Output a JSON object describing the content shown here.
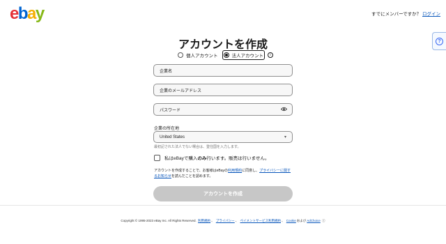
{
  "header": {
    "logo": {
      "e": "e",
      "b": "b",
      "a": "a",
      "y": "y"
    },
    "signin_prompt": "すでにメンバーですか？",
    "signin_link": "ログイン",
    "help_label": "?"
  },
  "form": {
    "title": "アカウントを作成",
    "account_types": [
      {
        "label": "個人アカウント",
        "selected": false
      },
      {
        "label": "法人アカウント",
        "selected": true
      }
    ],
    "info_icon": "i",
    "fields": {
      "company_name": {
        "placeholder": "企業名",
        "value": ""
      },
      "company_email": {
        "placeholder": "企業のメールアドレス",
        "value": ""
      },
      "password": {
        "placeholder": "パスワード",
        "value": ""
      }
    },
    "location_label": "企業の所在地",
    "location_value": "United States",
    "location_hint": "最初記された法人でない場合は、登住国を入力します。",
    "buy_only_label_prefix": "私はeBayで購入",
    "buy_only_label_bold": "のみ",
    "buy_only_label_suffix": "行います。販売は行いません。",
    "terms": {
      "part1": "アカウントを作成することで、お客様はeBayの",
      "link1": "利用規約",
      "part2": "に同意し、",
      "link2": "プライバシーに関するお知らせ",
      "part3": "を読んだことを認めます。"
    },
    "submit_label": "アカウントを作成"
  },
  "footer": {
    "copyright": "Copyright © 1995-2023 eBay Inc. All Rights Reserved.",
    "links": [
      "利用規約",
      "プライバシー",
      "ペイメントサービス利用規約",
      "Cookie"
    ],
    "adchoice_prefix": "および",
    "adchoice": "AdChoice"
  },
  "colors": {
    "brand_red": "#e53238",
    "brand_blue": "#0064d2",
    "brand_yellow": "#f5af02",
    "brand_green": "#86b817",
    "link": "#0654ba",
    "button_disabled": "#c7c7c7"
  }
}
